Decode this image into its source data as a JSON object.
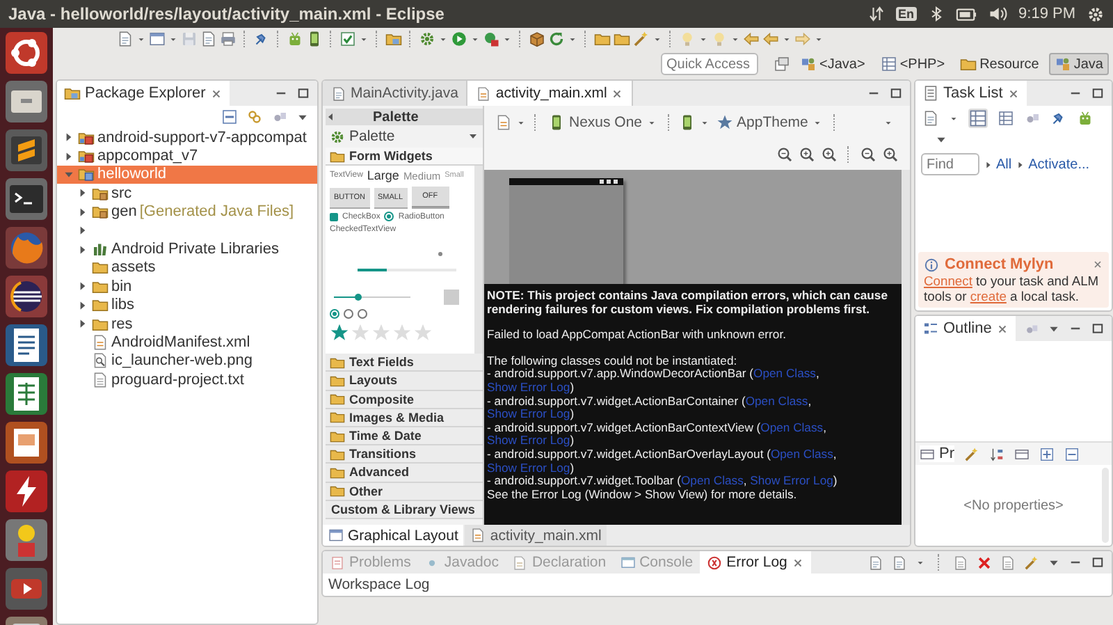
{
  "window": {
    "title": "Java - helloworld/res/layout/activity_main.xml - Eclipse"
  },
  "system_tray": {
    "keyboard": "En",
    "clock": "9:19 PM"
  },
  "quick_access": {
    "placeholder": "Quick Access"
  },
  "perspectives": [
    {
      "label": "<Java>",
      "selected": false
    },
    {
      "label": "<PHP>",
      "selected": false
    },
    {
      "label": "Resource",
      "selected": false
    },
    {
      "label": "Java",
      "selected": true
    }
  ],
  "package_explorer": {
    "title": "Package Explorer",
    "tree": [
      {
        "label": "android-support-v7-appcompat",
        "kind": "library_project",
        "expanded": false,
        "selected": false
      },
      {
        "label": "appcompat_v7",
        "kind": "library_project",
        "expanded": false,
        "selected": false
      },
      {
        "label": "helloworld",
        "kind": "project",
        "expanded": true,
        "selected": true,
        "children": [
          {
            "label": "src",
            "kind": "source_folder",
            "expanded": false,
            "selected": false
          },
          {
            "label": "gen",
            "decoration": "[Generated Java Files]",
            "kind": "source_folder",
            "expanded": false,
            "selected": false
          },
          {
            "kind": "blank",
            "expanded": false,
            "selected": false
          },
          {
            "label": "Android Private Libraries",
            "kind": "libraries",
            "expanded": false,
            "selected": false
          },
          {
            "label": "assets",
            "kind": "folder",
            "selected": false
          },
          {
            "label": "bin",
            "kind": "folder",
            "expanded": false,
            "selected": false
          },
          {
            "label": "libs",
            "kind": "folder",
            "expanded": false,
            "selected": false
          },
          {
            "label": "res",
            "kind": "folder",
            "expanded": false,
            "selected": false
          },
          {
            "label": "AndroidManifest.xml",
            "kind": "file_xml",
            "selected": false
          },
          {
            "label": "ic_launcher-web.png",
            "kind": "file_image",
            "selected": false
          },
          {
            "label": "proguard-project.txt",
            "kind": "file_text",
            "selected": false
          }
        ]
      }
    ]
  },
  "editor": {
    "tabs": [
      {
        "label": "MainActivity.java",
        "selected": false
      },
      {
        "label": "activity_main.xml",
        "selected": true
      }
    ],
    "palette": {
      "title": "Palette",
      "dropdown": "Palette",
      "open_section": "Form Widgets",
      "preview": {
        "text_sizes": [
          "TextView",
          "Large",
          "Medium",
          "Small"
        ],
        "buttons": [
          "BUTTON",
          "SMALL",
          "OFF"
        ],
        "checkbox": {
          "label": "CheckBox",
          "checked": true
        },
        "radio": {
          "label": "RadioButton",
          "selected": true
        },
        "checked_text": "CheckedTextView",
        "progress": {
          "level": 0.3
        },
        "seekbar": {
          "level": 0.3
        },
        "radio_group": [
          {
            "selected": true
          },
          {
            "selected": false
          },
          {
            "selected": false
          }
        ],
        "rating": {
          "stars": 1
        }
      },
      "sections": [
        "Text Fields",
        "Layouts",
        "Composite",
        "Images & Media",
        "Time & Date",
        "Transitions",
        "Advanced",
        "Other"
      ],
      "custom_section": "Custom & Library Views"
    },
    "canvas_toolbar": {
      "device": "Nexus One",
      "theme": "AppTheme"
    },
    "error_panel": {
      "note": "NOTE: This project contains Java compilation errors, which can cause rendering failures for custom views. Fix compilation problems first.",
      "message": "Failed to load AppCompat ActionBar with unknown error.",
      "intro": "The following classes could not be instantiated:",
      "classes": [
        {
          "text_1": "- android.support.v7.app.WindowDecorActionBar (",
          "link_1": "Open Class",
          "text_2": ", ",
          "link_2": "Show Error Log",
          "text_3": ")"
        },
        {
          "text_1": "- android.support.v7.widget.ActionBarContainer (",
          "link_1": "Open Class",
          "text_2": ", ",
          "link_2": "Show Error Log",
          "text_3": ")"
        },
        {
          "text_1": "- android.support.v7.widget.ActionBarContextView (",
          "link_1": "Open Class",
          "text_2": ", ",
          "link_2": "Show Error Log",
          "text_3": ")"
        },
        {
          "text_1": "- android.support.v7.widget.ActionBarOverlayLayout (",
          "link_1": "Open Class",
          "text_2": ", ",
          "link_2": "Show Error Log",
          "text_3": ")"
        },
        {
          "text_1": "- android.support.v7.widget.Toolbar (",
          "link_1": "Open Class",
          "text_2": ", ",
          "link_2": "Show Error Log",
          "text_3": ")"
        }
      ],
      "footer": "See the Error Log (Window > Show View) for more details."
    },
    "bottom_tabs": [
      {
        "label": "Graphical Layout",
        "selected": true
      },
      {
        "label": "activity_main.xml",
        "selected": false
      }
    ]
  },
  "task_list": {
    "title": "Task List",
    "find": {
      "placeholder": "Find"
    },
    "filters": [
      "All",
      "Activate..."
    ],
    "mylyn": {
      "title": "Connect Mylyn",
      "text": {
        "link_1": "Connect",
        "text_1": " to your task and ALM tools or ",
        "link_2": "create",
        "text_2": " a local task."
      }
    }
  },
  "outline": {
    "title": "Outline"
  },
  "properties": {
    "title": "Pr",
    "empty": "<No properties>"
  },
  "bottom_panel": {
    "tabs": [
      {
        "label": "Problems",
        "kind": "problems",
        "selected": false
      },
      {
        "label": "Javadoc",
        "kind": "javadoc",
        "selected": false
      },
      {
        "label": "Declaration",
        "kind": "declaration",
        "selected": false
      },
      {
        "label": "Console",
        "kind": "console",
        "selected": false
      },
      {
        "label": "Error Log",
        "kind": "error_log",
        "selected": true
      }
    ],
    "content": "Workspace Log"
  }
}
